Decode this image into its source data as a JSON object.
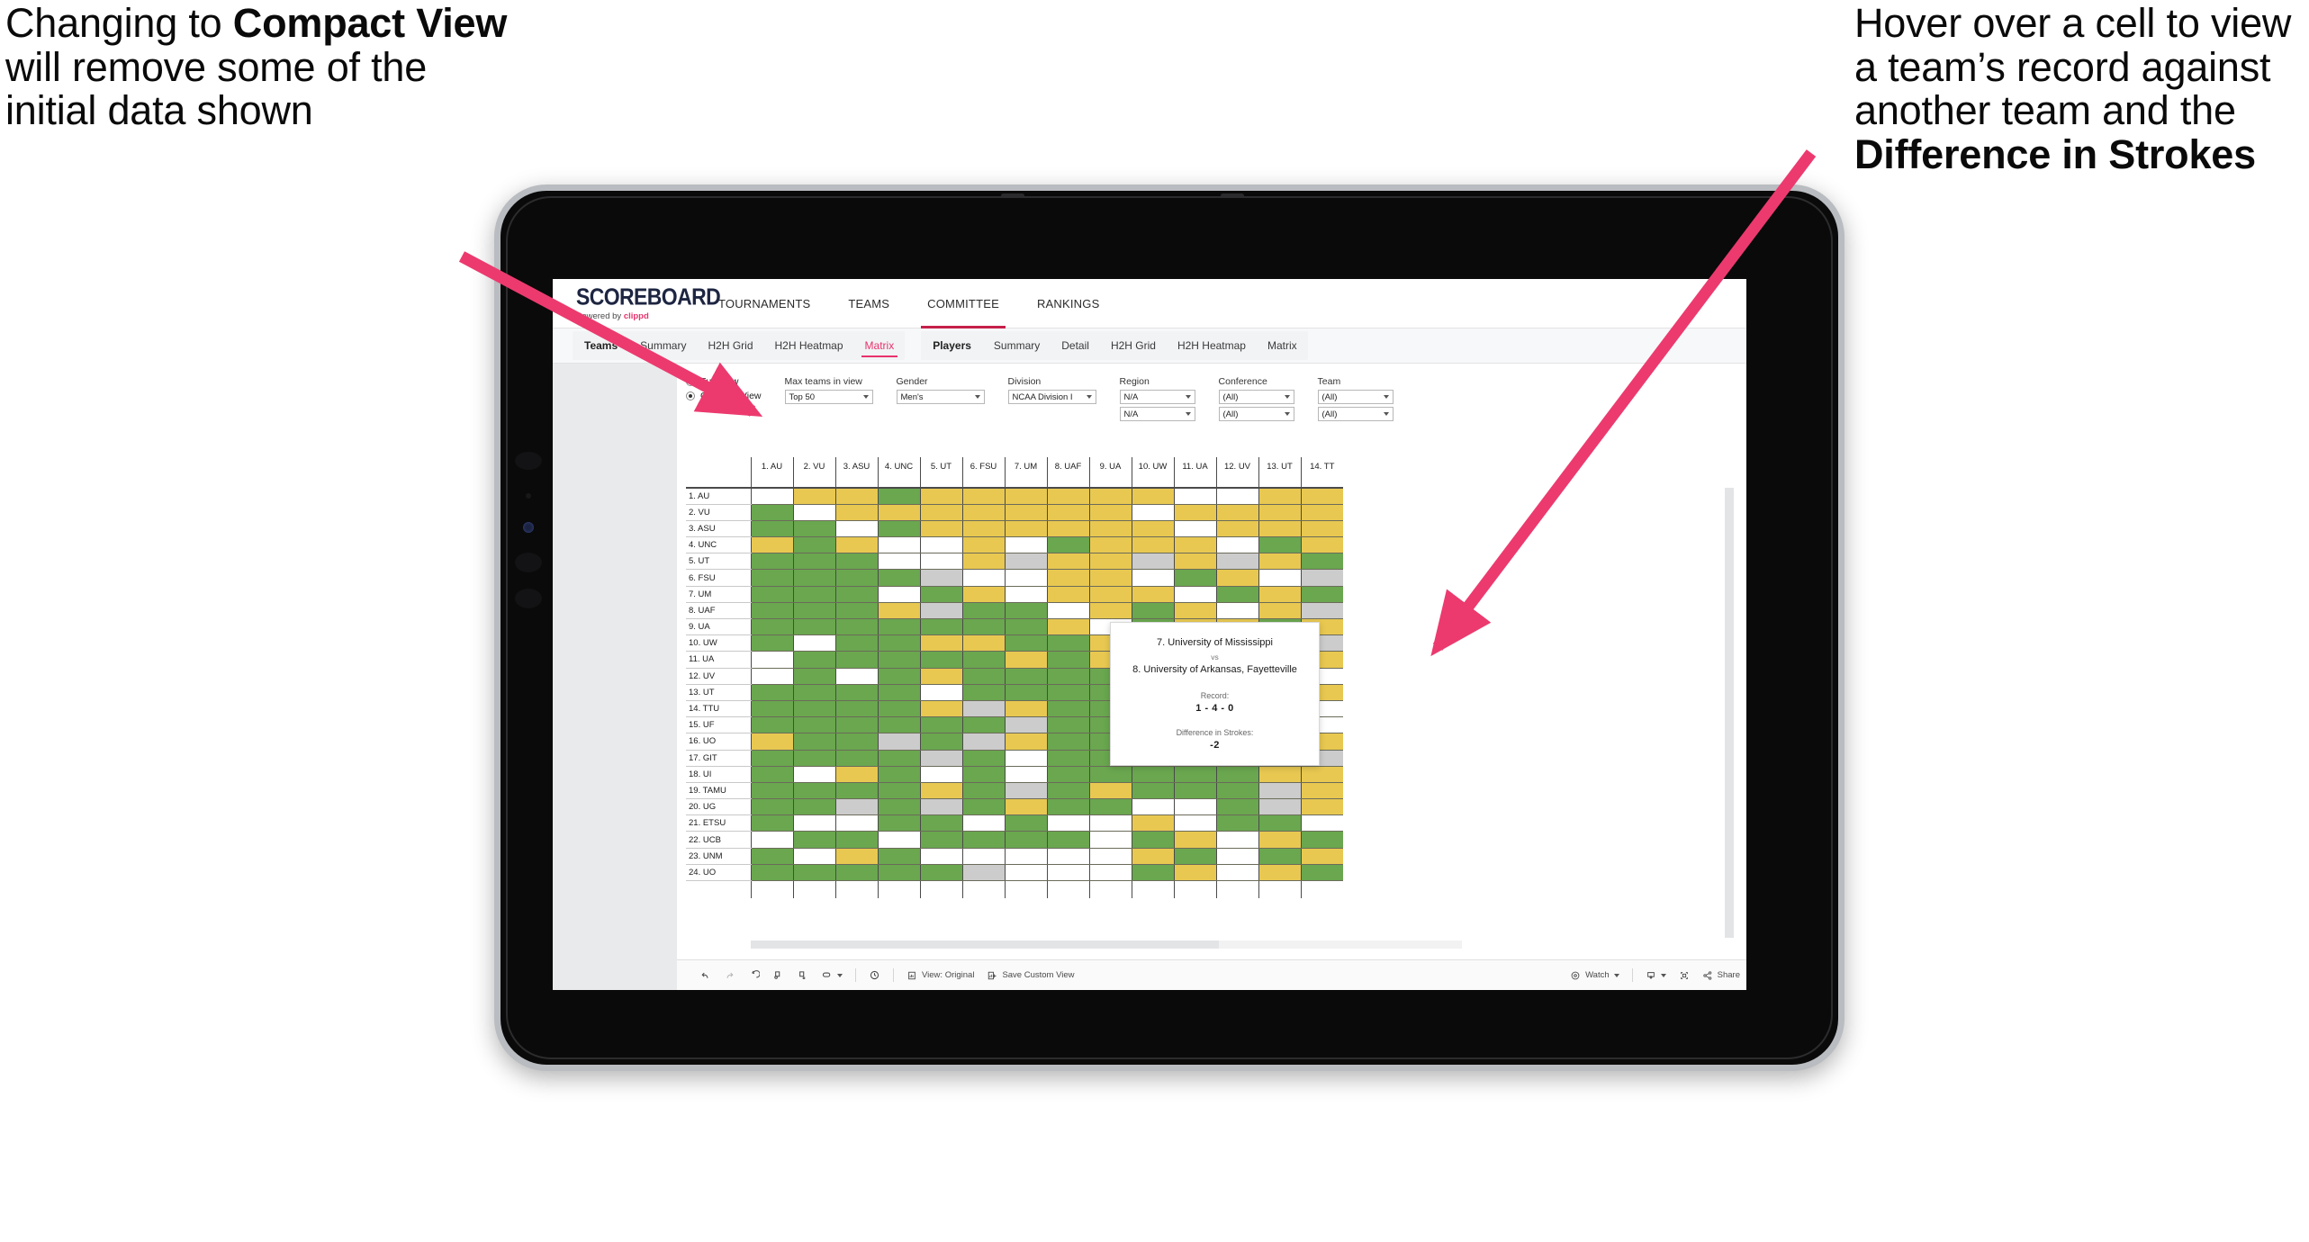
{
  "annotations": {
    "left": {
      "pre": "Changing to ",
      "bold": "Compact View",
      "post": " will remove some of the initial data shown"
    },
    "right": {
      "pre": "Hover over a cell to view a team’s record against another team and the ",
      "bold": "Difference in Strokes",
      "post": ""
    },
    "arrow_color": "#ec3a6e"
  },
  "app": {
    "logo": {
      "word": "SCOREBOARD",
      "powered_prefix": "Powered by ",
      "brand": "clippd"
    },
    "topnav": [
      {
        "label": "TOURNAMENTS",
        "active": false
      },
      {
        "label": "TEAMS",
        "active": false
      },
      {
        "label": "COMMITTEE",
        "active": true
      },
      {
        "label": "RANKINGS",
        "active": false
      }
    ],
    "subtabs": {
      "teams_group": {
        "lead": "Teams",
        "items": [
          {
            "label": "Summary",
            "active": false
          },
          {
            "label": "H2H Grid",
            "active": false
          },
          {
            "label": "H2H Heatmap",
            "active": false
          },
          {
            "label": "Matrix",
            "active": true
          }
        ]
      },
      "players_group": {
        "lead": "Players",
        "items": [
          {
            "label": "Summary",
            "active": false
          },
          {
            "label": "Detail",
            "active": false
          },
          {
            "label": "H2H Grid",
            "active": false
          },
          {
            "label": "H2H Heatmap",
            "active": false
          },
          {
            "label": "Matrix",
            "active": false
          }
        ]
      }
    },
    "accent_pink": "#e8336d",
    "accent_red": "#c5204a"
  },
  "filters": {
    "view_mode": {
      "full_label": "Full View",
      "compact_label": "Compact View",
      "selected": "Compact View"
    },
    "max_teams": {
      "label": "Max teams in view",
      "value": "Top 50"
    },
    "gender": {
      "label": "Gender",
      "value": "Men's"
    },
    "division": {
      "label": "Division",
      "value": "NCAA Division I"
    },
    "region": {
      "label": "Region",
      "value1": "N/A",
      "value2": "N/A"
    },
    "conference": {
      "label": "Conference",
      "value1": "(All)",
      "value2": "(All)"
    },
    "team": {
      "label": "Team",
      "value1": "(All)",
      "value2": "(All)"
    }
  },
  "matrix": {
    "columns": [
      "1. AU",
      "2. VU",
      "3. ASU",
      "4. UNC",
      "5. UT",
      "6. FSU",
      "7. UM",
      "8. UAF",
      "9. UA",
      "10. UW",
      "11. UA",
      "12. UV",
      "13. UT",
      "14. TT"
    ],
    "rows": [
      "1. AU",
      "2. VU",
      "3. ASU",
      "4. UNC",
      "5. UT",
      "6. FSU",
      "7. UM",
      "8. UAF",
      "9. UA",
      "10. UW",
      "11. UA",
      "12. UV",
      "13. UT",
      "14. TTU",
      "15. UF",
      "16. UO",
      "17. GIT",
      "18. UI",
      "19. TAMU",
      "20. UG",
      "21. ETSU",
      "22. UCB",
      "23. UNM",
      "24. UO"
    ],
    "legend_colors": {
      "win": "#6aa74f",
      "loss": "#e8c851",
      "none": "#ffffff",
      "tie": "#cccccc"
    },
    "cells": [
      [
        "w",
        "y",
        "y",
        "g",
        "y",
        "y",
        "y",
        "y",
        "y",
        "y",
        "w",
        "w",
        "y",
        "y"
      ],
      [
        "g",
        "w",
        "y",
        "y",
        "y",
        "y",
        "y",
        "y",
        "y",
        "w",
        "y",
        "y",
        "y",
        "y"
      ],
      [
        "g",
        "g",
        "w",
        "g",
        "y",
        "y",
        "y",
        "y",
        "y",
        "y",
        "w",
        "y",
        "y",
        "y"
      ],
      [
        "y",
        "g",
        "y",
        "w",
        "w",
        "y",
        "w",
        "g",
        "y",
        "y",
        "y",
        "w",
        "g",
        "y"
      ],
      [
        "g",
        "g",
        "g",
        "w",
        "w",
        "y",
        "x",
        "y",
        "y",
        "x",
        "y",
        "x",
        "y",
        "g"
      ],
      [
        "g",
        "g",
        "g",
        "g",
        "x",
        "w",
        "w",
        "y",
        "y",
        "w",
        "g",
        "y",
        "w",
        "x"
      ],
      [
        "g",
        "g",
        "g",
        "w",
        "g",
        "y",
        "w",
        "y",
        "y",
        "y",
        "w",
        "g",
        "y",
        "g"
      ],
      [
        "g",
        "g",
        "g",
        "y",
        "x",
        "g",
        "g",
        "w",
        "y",
        "g",
        "y",
        "w",
        "y",
        "x"
      ],
      [
        "g",
        "g",
        "g",
        "g",
        "g",
        "g",
        "g",
        "y",
        "w",
        "g",
        "y",
        "y",
        "g",
        "y"
      ],
      [
        "g",
        "w",
        "g",
        "g",
        "y",
        "y",
        "g",
        "g",
        "y",
        "w",
        "g",
        "y",
        "y",
        "x"
      ],
      [
        "w",
        "g",
        "g",
        "g",
        "g",
        "g",
        "y",
        "g",
        "y",
        "w",
        "w",
        "y",
        "y",
        "y"
      ],
      [
        "w",
        "g",
        "w",
        "g",
        "y",
        "g",
        "g",
        "g",
        "g",
        "g",
        "g",
        "w",
        "y",
        "w"
      ],
      [
        "g",
        "g",
        "g",
        "g",
        "w",
        "g",
        "g",
        "g",
        "g",
        "g",
        "y",
        "w",
        "w",
        "y"
      ],
      [
        "g",
        "g",
        "g",
        "g",
        "y",
        "x",
        "y",
        "g",
        "g",
        "g",
        "w",
        "w",
        "g",
        "w"
      ],
      [
        "g",
        "g",
        "g",
        "g",
        "g",
        "g",
        "x",
        "g",
        "g",
        "g",
        "w",
        "g",
        "g",
        "w"
      ],
      [
        "y",
        "g",
        "g",
        "x",
        "g",
        "x",
        "y",
        "g",
        "g",
        "g",
        "w",
        "g",
        "g",
        "y"
      ],
      [
        "g",
        "g",
        "g",
        "g",
        "x",
        "g",
        "w",
        "g",
        "g",
        "g",
        "g",
        "g",
        "y",
        "x"
      ],
      [
        "g",
        "w",
        "y",
        "g",
        "w",
        "g",
        "w",
        "g",
        "g",
        "g",
        "g",
        "g",
        "y",
        "y"
      ],
      [
        "g",
        "g",
        "g",
        "g",
        "y",
        "g",
        "x",
        "g",
        "y",
        "g",
        "g",
        "g",
        "x",
        "y"
      ],
      [
        "g",
        "g",
        "x",
        "g",
        "x",
        "g",
        "y",
        "g",
        "g",
        "w",
        "w",
        "g",
        "x",
        "y"
      ],
      [
        "g",
        "w",
        "w",
        "g",
        "g",
        "w",
        "g",
        "w",
        "w",
        "y",
        "w",
        "g",
        "g",
        "w"
      ],
      [
        "w",
        "g",
        "g",
        "w",
        "g",
        "g",
        "g",
        "g",
        "w",
        "g",
        "y",
        "w",
        "y",
        "g"
      ],
      [
        "g",
        "w",
        "y",
        "g",
        "w",
        "w",
        "w",
        "w",
        "w",
        "y",
        "g",
        "w",
        "g",
        "y"
      ],
      [
        "g",
        "g",
        "g",
        "g",
        "g",
        "x",
        "w",
        "w",
        "w",
        "g",
        "y",
        "w",
        "y",
        "g"
      ]
    ]
  },
  "tooltip": {
    "team_a": "7. University of Mississippi",
    "vs": "vs",
    "team_b": "8. University of Arkansas, Fayetteville",
    "record_label": "Record:",
    "record_value": "1 - 4 - 0",
    "strokes_label": "Difference in Strokes:",
    "strokes_value": "-2"
  },
  "toolbar": {
    "undo": "undo-icon",
    "redo": "redo-icon",
    "revert": "revert-icon",
    "refresh": "refresh-data-icon",
    "pause": "pause-updates-icon",
    "view_original": "View: Original",
    "save_custom_view": "Save Custom View",
    "watch": "Watch",
    "share": "Share"
  }
}
